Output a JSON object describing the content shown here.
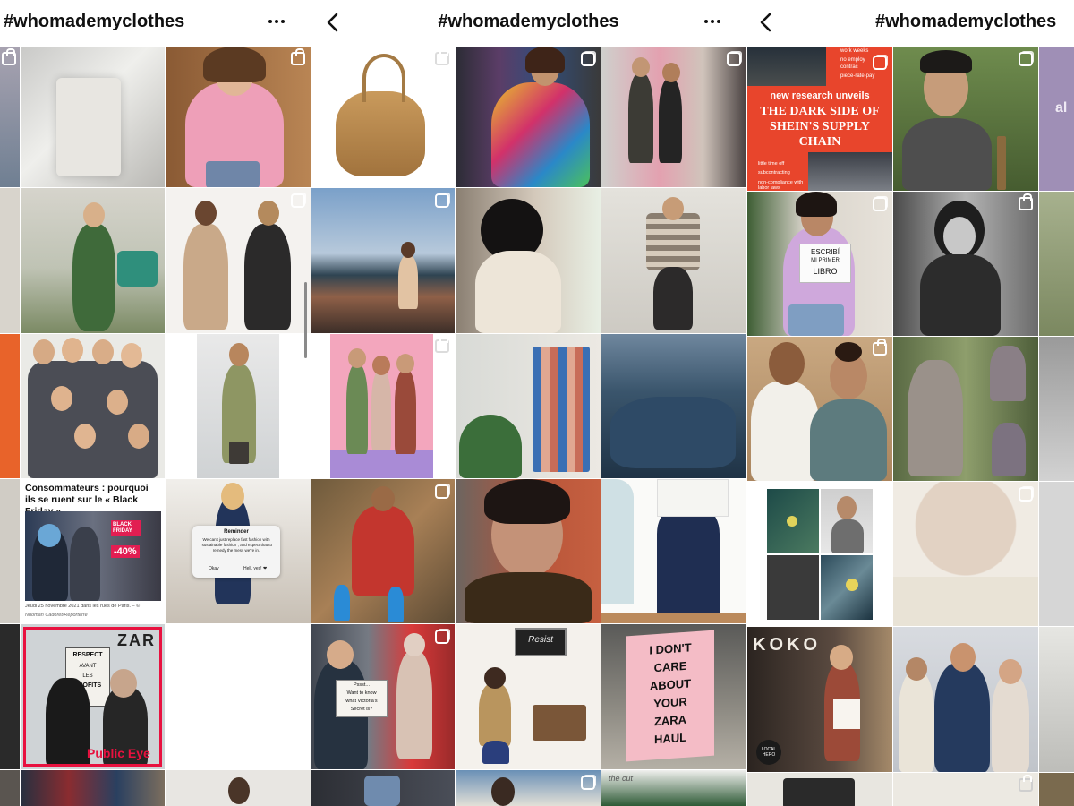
{
  "panels": [
    {
      "title": "#whomademyclothes",
      "back": false,
      "more": true
    },
    {
      "title": "#whomademyclothes",
      "back": true,
      "more": true
    },
    {
      "title": "#whomademyclothes",
      "back": true,
      "more": false
    }
  ],
  "icons": {
    "back": "chevron-left-icon",
    "more": "more-horizontal-icon",
    "carousel": "multiple-posts-icon",
    "shop": "shopping-bag-icon"
  },
  "posts": {
    "shein": {
      "top_lines": [
        "work weeks",
        "no employ",
        "contrac",
        "piece-rate-pay"
      ],
      "kicker": "new research unveils",
      "headline": "THE DARK SIDE OF SHEIN'S SUPPLY CHAIN",
      "bottom_lines": [
        "little time off",
        "subcontracting",
        "non-compliance with labor laws"
      ],
      "accent": "#e8452c"
    },
    "libro": {
      "line1": "ESCRIBÍ",
      "line2": "MI PRIMER",
      "line3": "LIBRO"
    },
    "article": {
      "headline": "Consommateurs : pourquoi ils se ruent sur le « Black Friday »",
      "sign1": "BLACK FRIDAY",
      "sign2": "-40%",
      "caption": "Jeudi 25 novembre 2021 dans les rues de Paris. – ©",
      "credit": "Nnoman Cadoret/Reporterre"
    },
    "reminder": {
      "title": "Reminder",
      "body": "We can't just replace fast fashion with \"sustainable fashion\", and expect that to remedy the mess we're in.",
      "okay": "Okay",
      "hell_yes": "Hell, yes! ❤"
    },
    "zara": {
      "line1": "RESPECT",
      "line2": "AVANT",
      "line3": "LES",
      "line4": "PROFITS",
      "brand": "Public Eye",
      "store": "ZAR"
    },
    "vs_sign": {
      "line1": "Pssst...",
      "line2": "Want to know",
      "line3": "what Victoria's",
      "line4": "Secret is?"
    },
    "haul_sign": {
      "line1": "I DON'T",
      "line2": "CARE",
      "line3": "ABOUT",
      "line4": "YOUR",
      "line5": "ZARA",
      "line6": "HAUL"
    },
    "resist": "Resist",
    "thecut": "the cut",
    "koko": "KOKO",
    "local": "LOCAL HERO"
  },
  "colors": {
    "accent_orange": "#e8452c",
    "pink_bg": "#f0a3b8",
    "haul_pink": "#f4b9c4",
    "title": "#111111"
  }
}
